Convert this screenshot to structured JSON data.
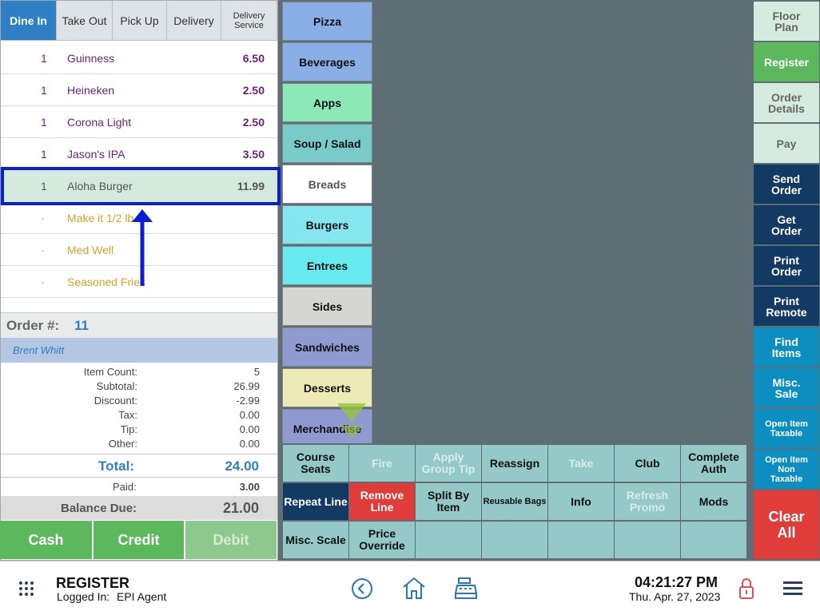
{
  "order_tabs": [
    "Dine In",
    "Take Out",
    "Pick Up",
    "Delivery",
    "Delivery Service"
  ],
  "order_items": [
    {
      "qty": "1",
      "name": "Guinness",
      "price": "6.50",
      "kind": "item"
    },
    {
      "qty": "1",
      "name": "Heineken",
      "price": "2.50",
      "kind": "item"
    },
    {
      "qty": "1",
      "name": "Corona Light",
      "price": "2.50",
      "kind": "item"
    },
    {
      "qty": "1",
      "name": "Jason's IPA",
      "price": "3.50",
      "kind": "item"
    },
    {
      "qty": "1",
      "name": "Aloha Burger",
      "price": "11.99",
      "kind": "selected"
    },
    {
      "qty": "·",
      "name": "Make it 1/2 lb.",
      "price": "",
      "kind": "modifier"
    },
    {
      "qty": "·",
      "name": "Med Well",
      "price": "",
      "kind": "modifier"
    },
    {
      "qty": "·",
      "name": "Seasoned Fries",
      "price": "",
      "kind": "modifier"
    }
  ],
  "order": {
    "number_label": "Order #:",
    "number": "11",
    "customer": "Brent Whitt"
  },
  "summary": [
    {
      "label": "Item Count:",
      "value": "5"
    },
    {
      "label": "Subtotal:",
      "value": "26.99"
    },
    {
      "label": "Discount:",
      "value": "-2.99"
    },
    {
      "label": "Tax:",
      "value": "0.00"
    },
    {
      "label": "Tip:",
      "value": "0.00"
    },
    {
      "label": "Other:",
      "value": "0.00"
    }
  ],
  "total": {
    "label": "Total:",
    "value": "24.00"
  },
  "paid": {
    "label": "Paid:",
    "value": "3.00"
  },
  "balance": {
    "label": "Balance Due:",
    "value": "21.00"
  },
  "payment_buttons": [
    "Cash",
    "Credit",
    "Debit"
  ],
  "categories": [
    {
      "label": "Pizza",
      "color": "#8aaee6"
    },
    {
      "label": "Beverages",
      "color": "#8aaee6"
    },
    {
      "label": "Apps",
      "color": "#8de8b8"
    },
    {
      "label": "Soup / Salad",
      "color": "#79cbc9"
    },
    {
      "label": "Breads",
      "color": "#ffffff"
    },
    {
      "label": "Burgers",
      "color": "#86e6ef"
    },
    {
      "label": "Entrees",
      "color": "#66eaf0"
    },
    {
      "label": "Sides",
      "color": "#d5d5d2"
    },
    {
      "label": "Sandwiches",
      "color": "#8e9ad0"
    },
    {
      "label": "Desserts",
      "color": "#edeab6"
    },
    {
      "label": "Merchandise",
      "color": "#8e9ad0"
    }
  ],
  "right_buttons": [
    {
      "label": "Floor Plan",
      "style": "pale"
    },
    {
      "label": "Register",
      "style": "green"
    },
    {
      "label": "Order Details",
      "style": "pale"
    },
    {
      "label": "Pay",
      "style": "pale"
    },
    {
      "label": "Send Order",
      "style": "navy"
    },
    {
      "label": "Get Order",
      "style": "navy"
    },
    {
      "label": "Print Order",
      "style": "navy"
    },
    {
      "label": "Print Remote",
      "style": "navy"
    },
    {
      "label": "Find Items",
      "style": "teal"
    },
    {
      "label": "Misc. Sale",
      "style": "teal"
    },
    {
      "label": "Open Item Taxable",
      "style": "teal-small"
    },
    {
      "label": "Open Item Non Taxable",
      "style": "teal-small"
    },
    {
      "label": "Clear All",
      "style": "red"
    }
  ],
  "action_grid": [
    [
      {
        "label": "Course Seats"
      },
      {
        "label": "Fire",
        "disabled": true
      },
      {
        "label": "Apply Group Tip",
        "disabled": true
      },
      {
        "label": "Reassign"
      },
      {
        "label": "Take",
        "disabled": true
      },
      {
        "label": "Club"
      },
      {
        "label": "Complete Auth"
      }
    ],
    [
      {
        "label": "Repeat Line",
        "style": "navy"
      },
      {
        "label": "Remove Line",
        "style": "red"
      },
      {
        "label": "Split By Item"
      },
      {
        "label": "Reusable Bags",
        "small": true
      },
      {
        "label": "Info"
      },
      {
        "label": "Refresh Promo",
        "disabled": true
      },
      {
        "label": "Mods"
      }
    ],
    [
      {
        "label": "Misc. Scale"
      },
      {
        "label": "Price Override"
      },
      {
        "label": ""
      },
      {
        "label": ""
      },
      {
        "label": ""
      },
      {
        "label": ""
      },
      {
        "label": ""
      }
    ]
  ],
  "footer": {
    "title": "REGISTER",
    "logged_in_label": "Logged In:",
    "user": "EPI Agent",
    "time": "04:21:27 PM",
    "date": "Thu. Apr. 27, 2023"
  },
  "colors": {
    "accent_blue": "#2e7fc3",
    "annotation_blue": "#0a1fd4",
    "navy": "#123a63",
    "green": "#5cb85c",
    "red": "#e03c3a",
    "teal": "#0c8fc0"
  }
}
